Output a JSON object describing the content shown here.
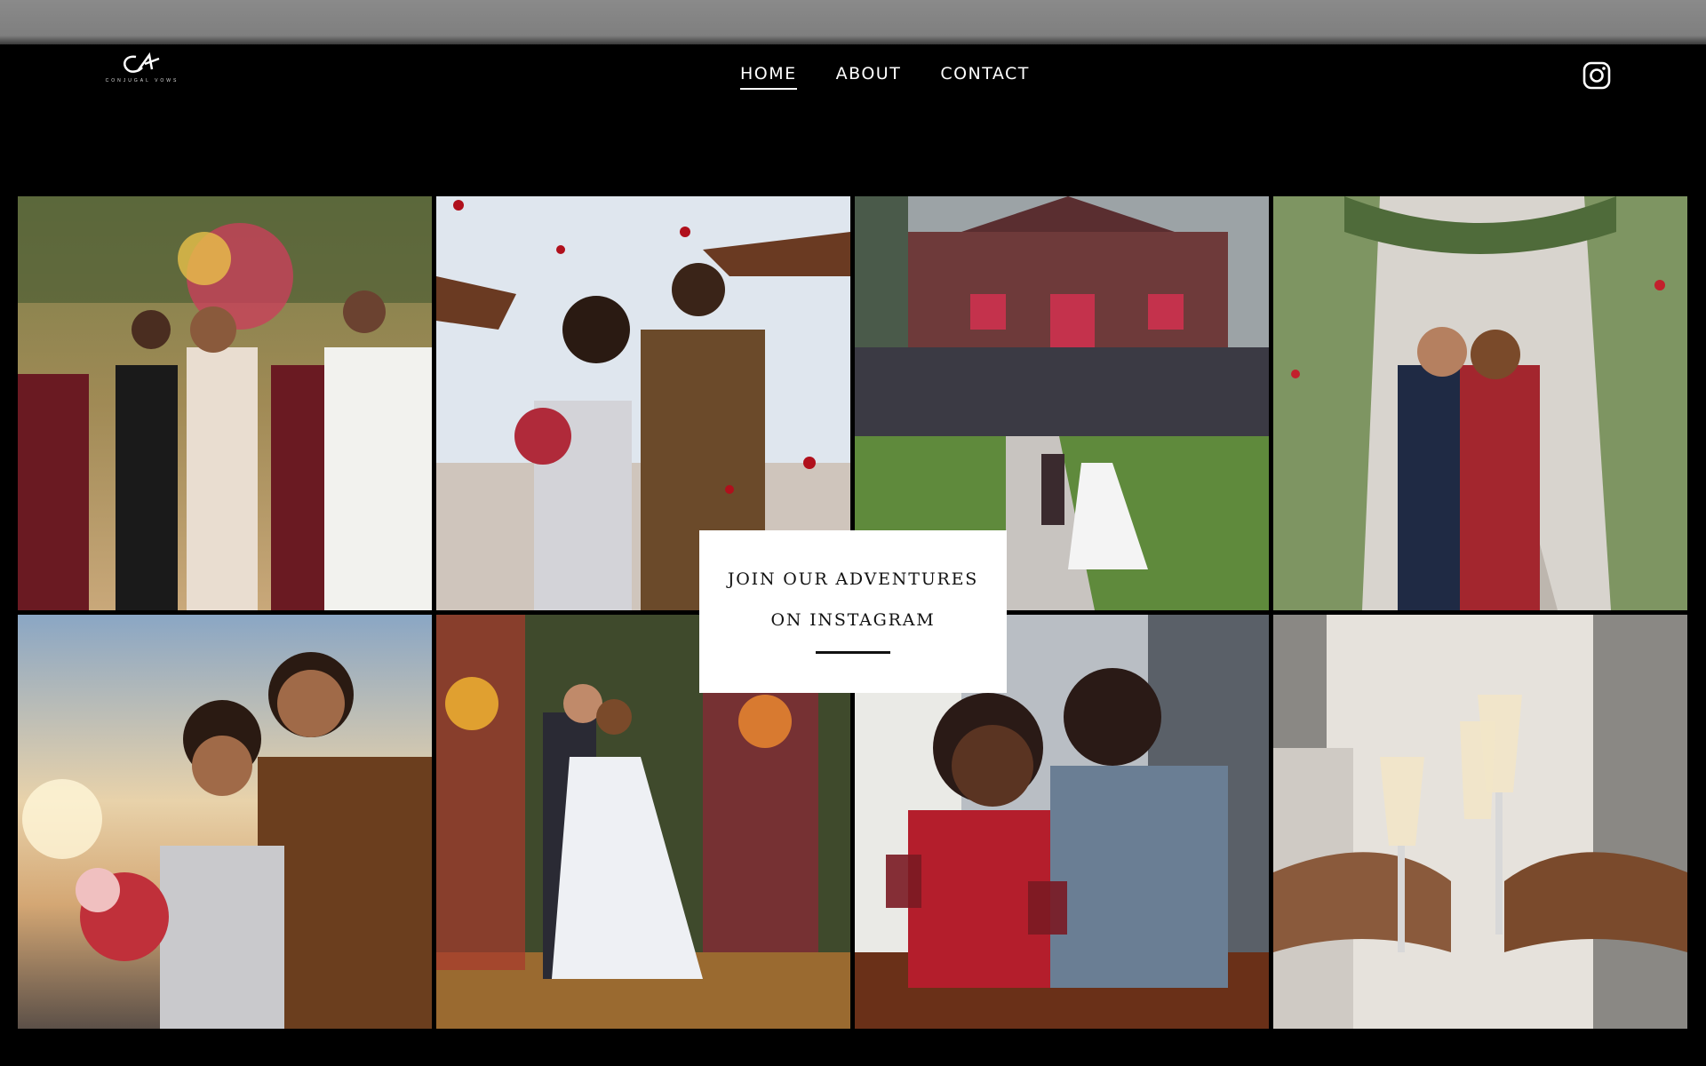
{
  "brand": {
    "logo_text": "CONJUGAL VOWS"
  },
  "nav": {
    "items": [
      {
        "label": "HOME",
        "active": true
      },
      {
        "label": "ABOUT",
        "active": false
      },
      {
        "label": "CONTACT",
        "active": false
      }
    ],
    "social_icon": "instagram-icon"
  },
  "gallery": {
    "photos": [
      "wedding-party-toast",
      "confetti-couple",
      "barn-group-photo",
      "rose-arch-couple",
      "sunset-couple",
      "floral-arch-couple",
      "wine-couple",
      "champagne-toast"
    ]
  },
  "instagram_card": {
    "line1": "JOIN OUR ADVENTURES",
    "line2": "ON INSTAGRAM"
  },
  "colors": {
    "background": "#000000",
    "nav_text": "#ffffff",
    "card_background": "#ffffff"
  }
}
